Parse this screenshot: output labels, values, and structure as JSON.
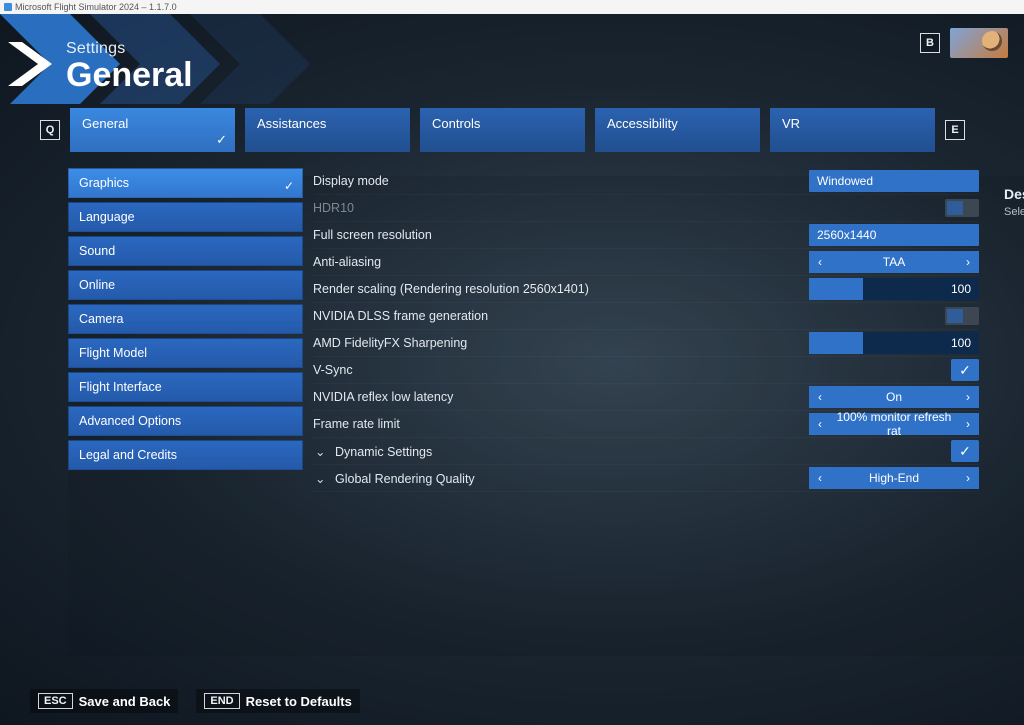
{
  "window": {
    "title": "Microsoft Flight Simulator 2024 – 1.1.7.0"
  },
  "header": {
    "crumb": "Settings",
    "title": "General"
  },
  "nav_keys": {
    "left": "Q",
    "right": "E",
    "profile_key": "B"
  },
  "tabs": [
    {
      "label": "General",
      "active": true
    },
    {
      "label": "Assistances",
      "active": false
    },
    {
      "label": "Controls",
      "active": false
    },
    {
      "label": "Accessibility",
      "active": false
    },
    {
      "label": "VR",
      "active": false
    }
  ],
  "sidebar": [
    {
      "label": "Graphics",
      "active": true
    },
    {
      "label": "Language"
    },
    {
      "label": "Sound"
    },
    {
      "label": "Online"
    },
    {
      "label": "Camera"
    },
    {
      "label": "Flight Model"
    },
    {
      "label": "Flight Interface"
    },
    {
      "label": "Advanced Options"
    },
    {
      "label": "Legal and Credits"
    }
  ],
  "settings": {
    "display_mode": {
      "label": "Display mode",
      "value": "Windowed",
      "type": "value"
    },
    "hdr10": {
      "label": "HDR10",
      "type": "toggle",
      "on": false,
      "disabled": true
    },
    "full_res": {
      "label": "Full screen resolution",
      "value": "2560x1440",
      "type": "value"
    },
    "aa": {
      "label": "Anti-aliasing",
      "value": "TAA",
      "type": "selector"
    },
    "render_scaling": {
      "label": "Render scaling (Rendering resolution 2560x1401)",
      "value": "100",
      "type": "slider",
      "pct": 32
    },
    "dlss_fg": {
      "label": "NVIDIA DLSS frame generation",
      "type": "toggle",
      "on": false
    },
    "amd_sharp": {
      "label": "AMD FidelityFX Sharpening",
      "value": "100",
      "type": "slider",
      "pct": 32
    },
    "vsync": {
      "label": "V-Sync",
      "type": "check",
      "on": true
    },
    "reflex": {
      "label": "NVIDIA reflex low latency",
      "value": "On",
      "type": "selector"
    },
    "frl": {
      "label": "Frame rate limit",
      "value": "100% monitor refresh rat",
      "type": "selector"
    },
    "dyn": {
      "label": "Dynamic Settings",
      "type": "check",
      "on": true,
      "sub": true
    },
    "grq": {
      "label": "Global Rendering Quality",
      "value": "High-End",
      "type": "selector",
      "sub": true
    }
  },
  "desc": {
    "heading": "Des",
    "sub": "Sele"
  },
  "footer": {
    "esc_key": "ESC",
    "esc_label": "Save and Back",
    "end_key": "END",
    "end_label": "Reset to Defaults"
  }
}
